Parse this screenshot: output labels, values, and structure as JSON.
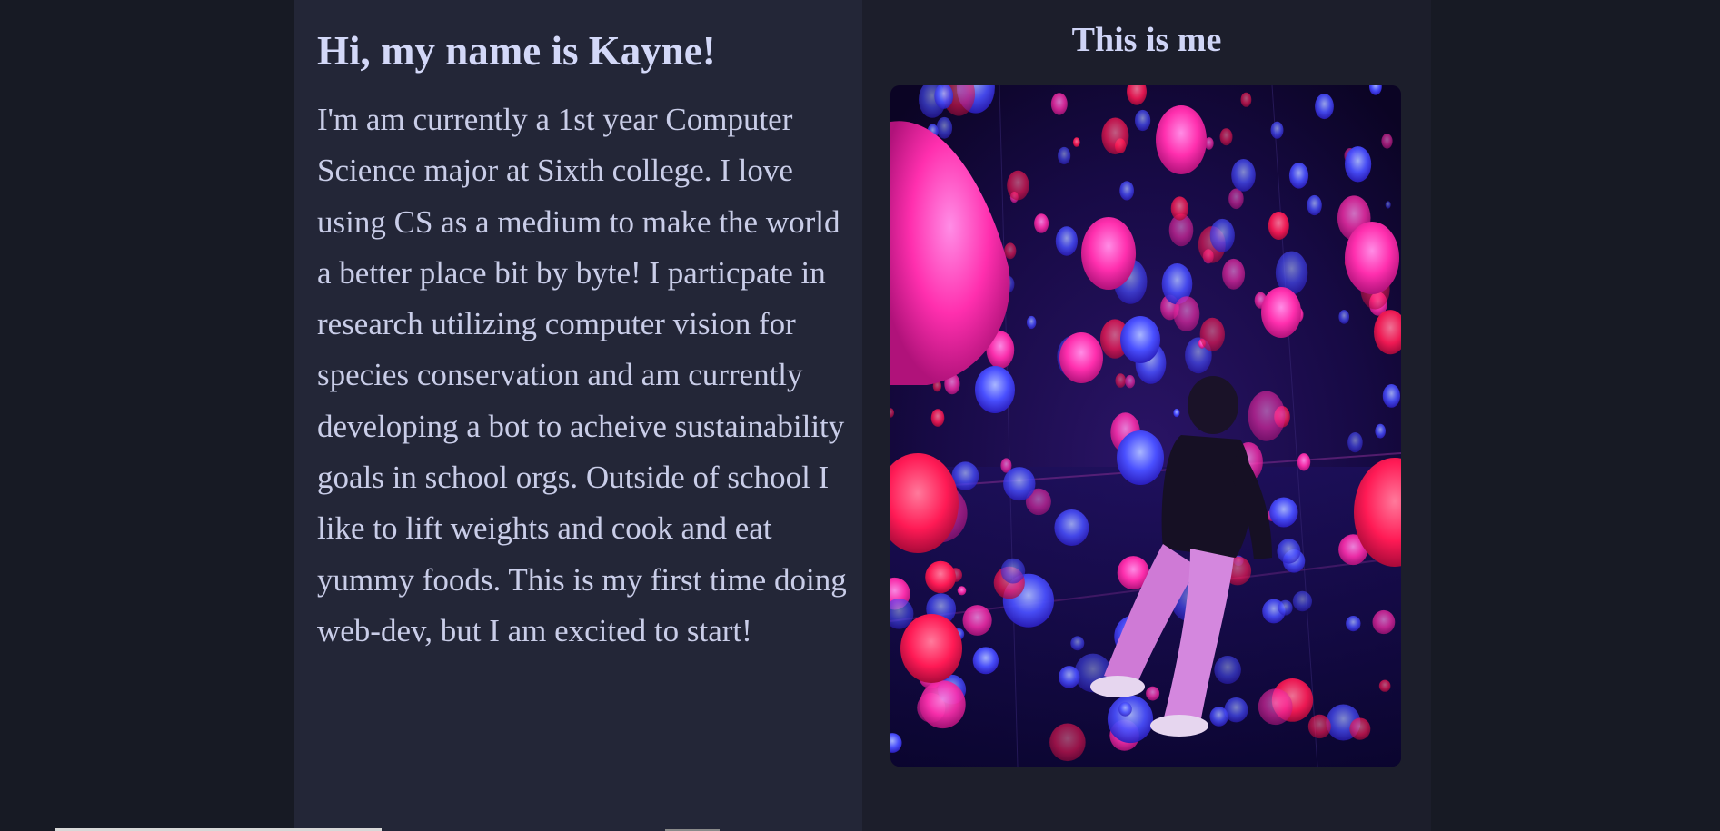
{
  "intro": {
    "heading": "Hi, my name is Kayne!",
    "bio": "I'm am currently a 1st year Computer Science major at Sixth college. I love using CS as a medium to make the world a better place bit by byte! I particpate in research utilizing computer vision for species conservation and am currently developing a bot to acheive sustainability goals in school orgs. Outside of school I like to lift weights and cook and eat yummy foods. This is my first time doing web-dev, but I am excited to start!"
  },
  "photo": {
    "caption": "This is me"
  },
  "colors": {
    "page_background": "#171a24",
    "left_panel": "#232637",
    "right_panel": "#1c1e2b",
    "heading_text": "#d3d8f8",
    "body_text": "#c9cde8"
  }
}
